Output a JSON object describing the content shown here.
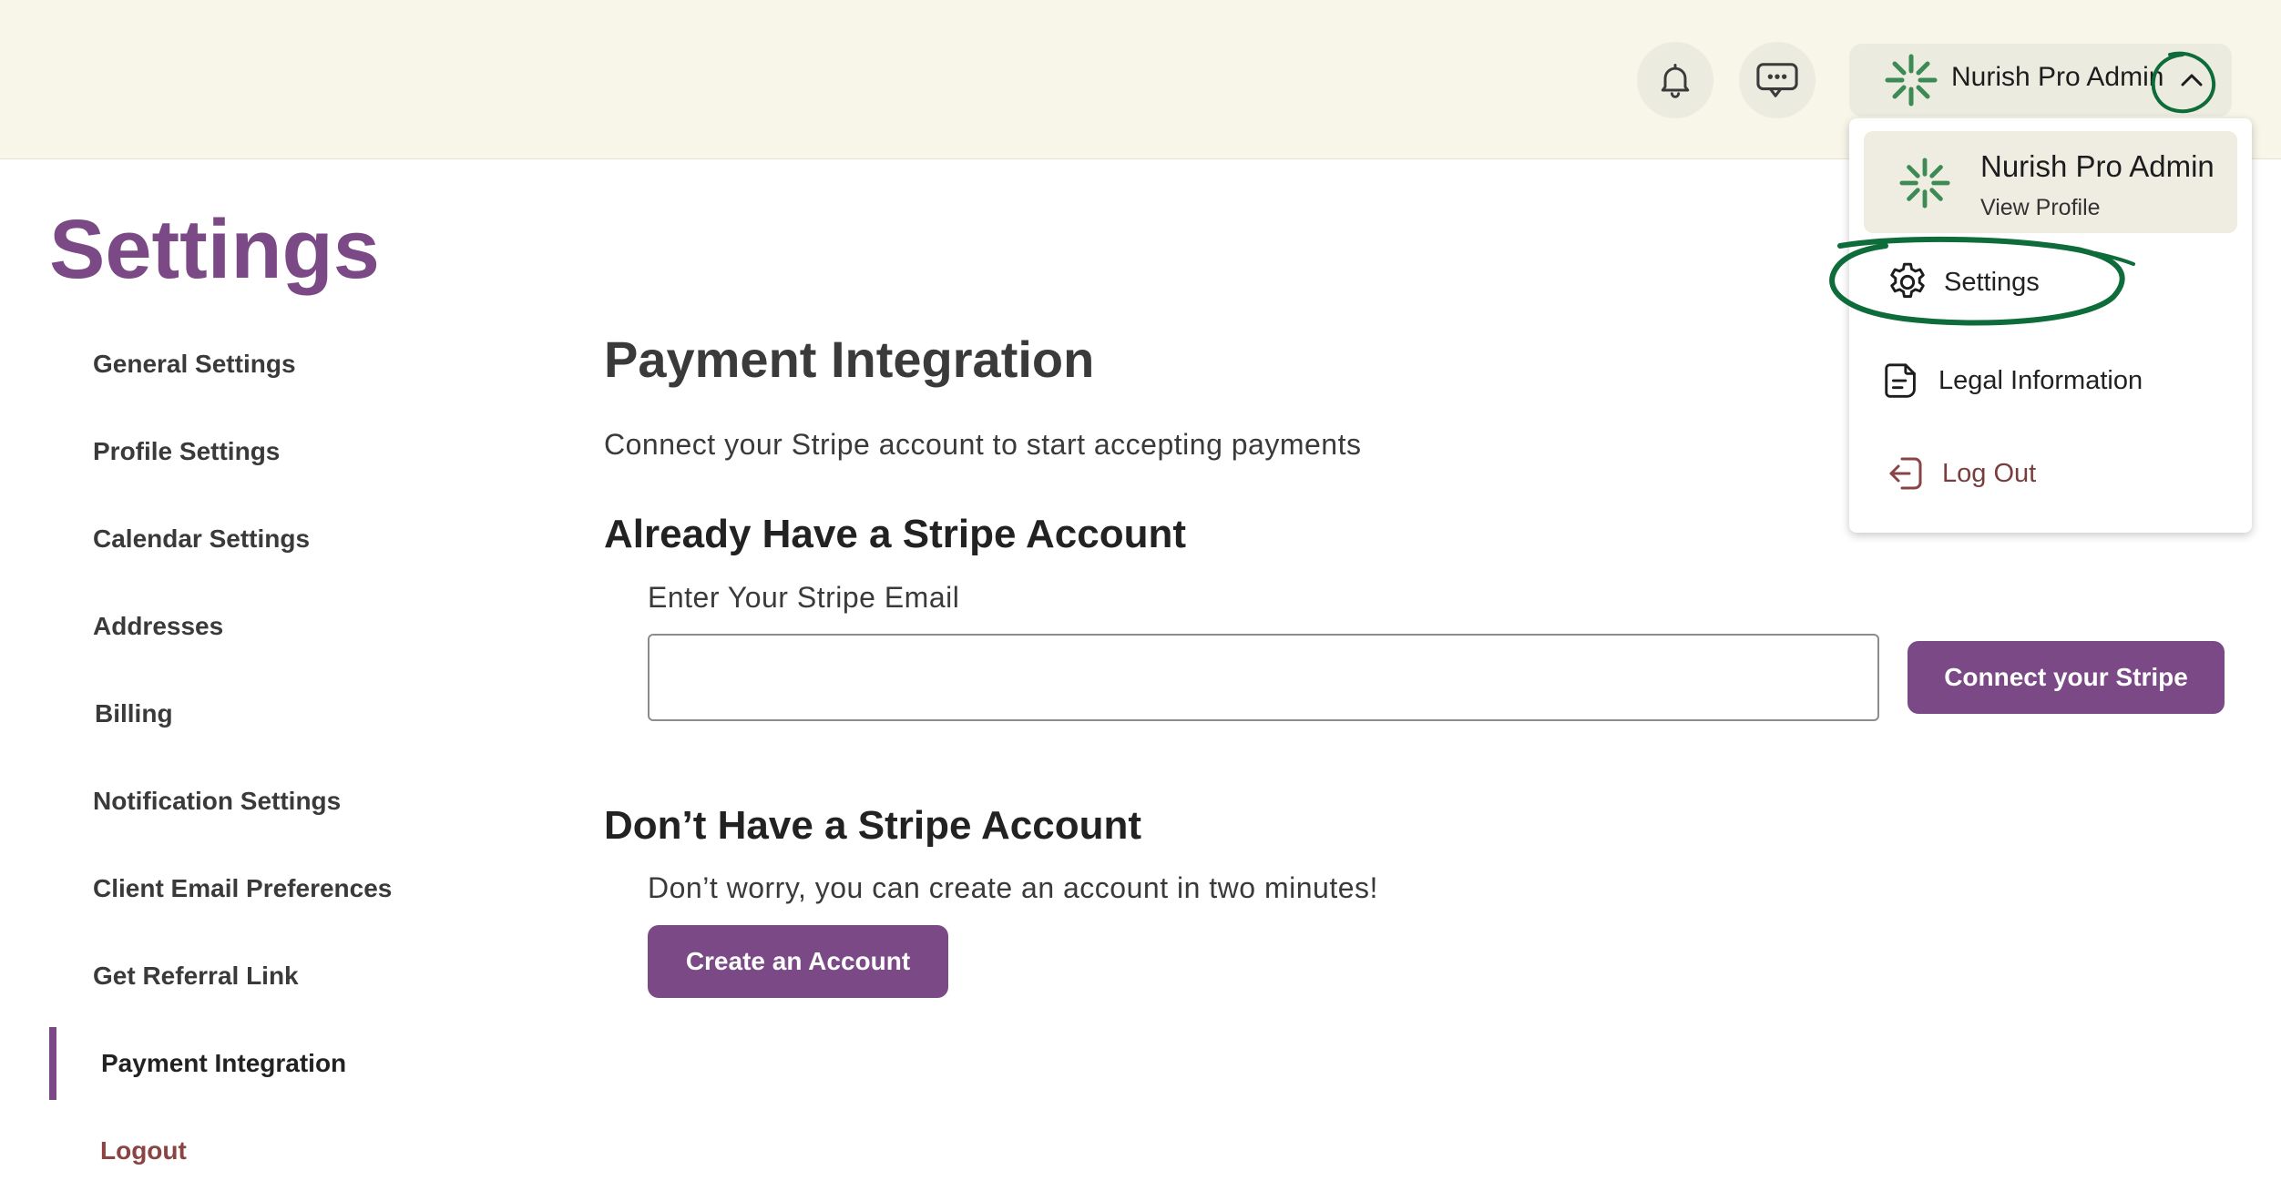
{
  "header": {
    "notifications_icon": "bell-icon",
    "messages_icon": "chat-bubble-icon",
    "profile": {
      "name": "Nurish Pro Admin",
      "logo_icon": "green-asterisk-logo"
    }
  },
  "dropdown": {
    "profile_name": "Nurish Pro Admin",
    "profile_sub": "View Profile",
    "items": [
      {
        "label": "Settings",
        "icon": "gear-icon"
      },
      {
        "label": "Legal Information",
        "icon": "document-icon"
      },
      {
        "label": "Log Out",
        "icon": "logout-icon"
      }
    ]
  },
  "page": {
    "title": "Settings"
  },
  "sidebar": {
    "items": [
      {
        "label": "General Settings"
      },
      {
        "label": "Profile Settings"
      },
      {
        "label": "Calendar Settings"
      },
      {
        "label": "Addresses"
      },
      {
        "label": "Billing"
      },
      {
        "label": "Notification Settings"
      },
      {
        "label": "Client Email Preferences"
      },
      {
        "label": "Get Referral Link"
      },
      {
        "label": "Payment Integration",
        "active": true
      },
      {
        "label": "Logout"
      }
    ]
  },
  "main": {
    "title": "Payment Integration",
    "description": "Connect your Stripe account to start accepting payments",
    "existing": {
      "heading": "Already Have a Stripe Account",
      "field_label": "Enter Your Stripe Email",
      "email_value": "",
      "button_label": "Connect your Stripe"
    },
    "new": {
      "heading": "Don’t Have a Stripe Account",
      "text": "Don’t worry, you can create an account in two minutes!",
      "button_label": "Create an Account"
    }
  },
  "colors": {
    "brand_purple": "#7b4a86",
    "header_bg": "#f8f6e9",
    "logo_green": "#3e8a55",
    "annotation_green": "#0e6b3a",
    "logout_red": "#8a4444"
  }
}
